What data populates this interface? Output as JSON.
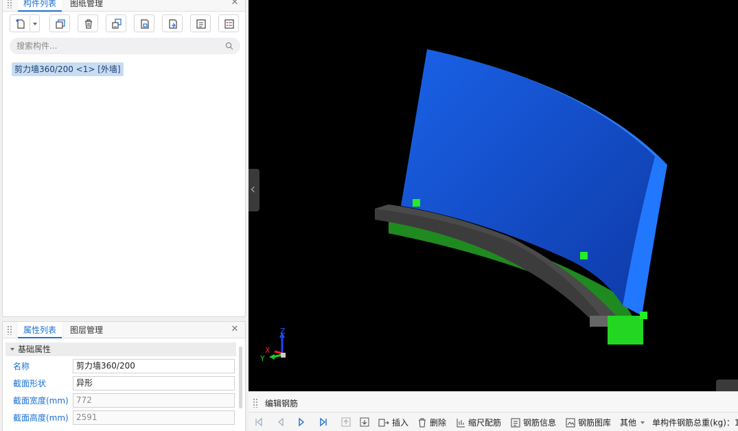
{
  "component_panel": {
    "tabs": [
      "构件列表",
      "图纸管理"
    ],
    "search_placeholder": "搜索构件...",
    "selected_item": "剪力墙360/200 <1> [外墙]"
  },
  "property_panel": {
    "tabs": [
      "属性列表",
      "图层管理"
    ],
    "group": "基础属性",
    "rows": [
      {
        "name": "名称",
        "value": "剪力墙360/200"
      },
      {
        "name": "截面形状",
        "value": "异形"
      },
      {
        "name": "截面宽度(mm)",
        "value": "772"
      },
      {
        "name": "截面高度(mm)",
        "value": "2591"
      }
    ]
  },
  "viewport": {
    "axis_labels": {
      "z": "Z",
      "x": "X",
      "y": "Y"
    },
    "colors": {
      "wall": "#1a5ad8",
      "wall_edge": "#1e6ff0",
      "slab": "#3a3a3a",
      "base": "#1f8f1f",
      "handle": "#22dd22"
    }
  },
  "rebar_panel": {
    "title": "编辑钢筋",
    "insert_label": "插入",
    "delete_label": "删除",
    "scale_label": "缩尺配筋",
    "info_label": "钢筋信息",
    "library_label": "钢筋图库",
    "other_label": "其他",
    "total_label": "单构件钢筋总重(kg)：1"
  }
}
